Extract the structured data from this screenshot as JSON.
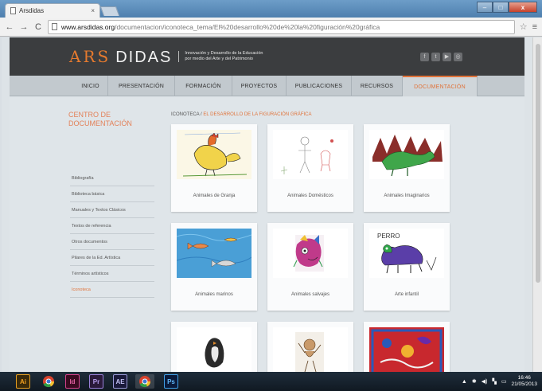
{
  "browser": {
    "tab_title": "Arsdidas",
    "tab_close": "×",
    "back": "←",
    "forward": "→",
    "reload": "C",
    "url_host": "www.arsdidas.org",
    "url_path": "/documentacion/iconoteca_tema/El%20desarrollo%20de%20la%20figuración%20gráfica",
    "bookmark_star": "☆",
    "menu_wrench": "≡",
    "win_min": "–",
    "win_max": "□",
    "win_close": "x"
  },
  "site": {
    "logo_ars": "ARS",
    "logo_didas": "DIDAS",
    "tagline_line1": "Innovación y Desarrollo de la Educación",
    "tagline_line2": "por medio del Arte y del Patrimonio",
    "social": [
      "f",
      "t",
      "▶",
      "◎"
    ]
  },
  "nav": [
    "INICIO",
    "PRESENTACIÓN",
    "FORMACIÓN",
    "PROYECTOS",
    "PUBLICACIONES",
    "RECURSOS",
    "DOCUMENTACIÓN"
  ],
  "sidebar": {
    "title": "CENTRO DE DOCUMENTACIÓN",
    "items": [
      "Bibliografía",
      "Biblioteca básica",
      "Manuales y Textos Clásicos",
      "Textos de referencia",
      "Otros documentos",
      "Pilares de la Ed. Artística",
      "Términos artísticos",
      "Iconoteca"
    ]
  },
  "breadcrumb": {
    "root": "ICONOTECA",
    "sep": " / ",
    "current": "EL DESARROLLO DE LA FIGURACIÓN GRÁFICA"
  },
  "cards": [
    "Animales de Granja",
    "Animales Domésticos",
    "Animales Imaginarios",
    "Animales marinos",
    "Animales salvajes",
    "Arte infantil",
    "",
    "",
    ""
  ],
  "drawing_text": {
    "perro": "PERRO"
  },
  "taskbar": {
    "apps": [
      "Ai",
      "",
      "Id",
      "Pr",
      "AE",
      "",
      "Ps"
    ],
    "time": "16:46",
    "date": "21/05/2013"
  }
}
